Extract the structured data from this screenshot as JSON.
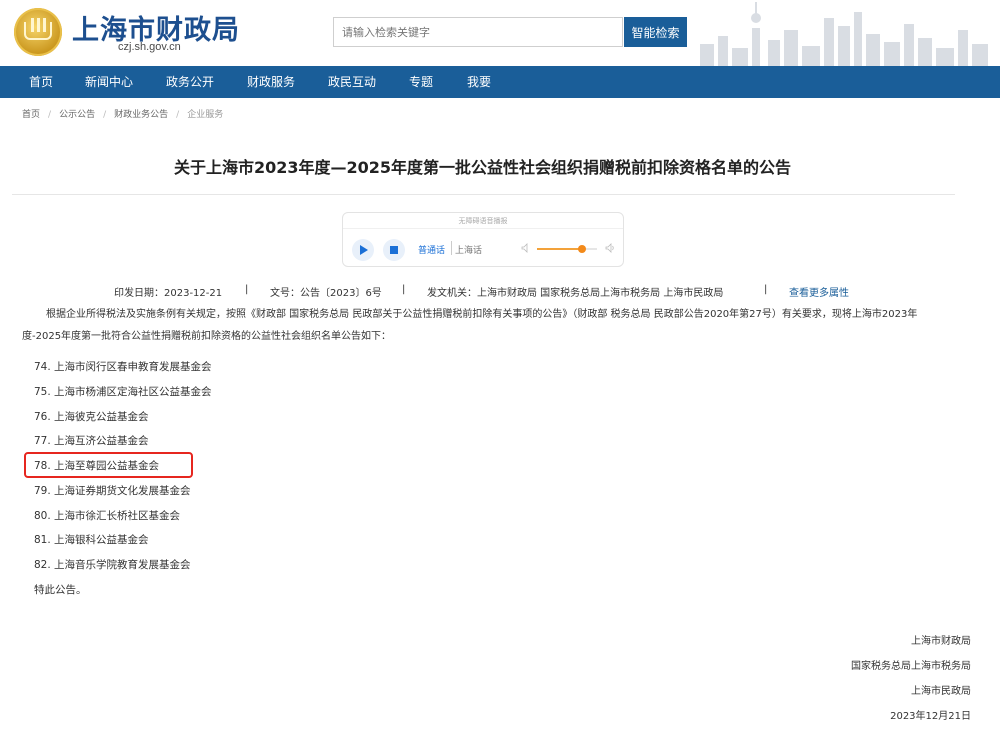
{
  "header": {
    "site_title": "上海市财政局",
    "site_url": "czj.sh.gov.cn",
    "search_placeholder": "请输入检索关键字",
    "search_button": "智能检索"
  },
  "nav": [
    "首页",
    "新闻中心",
    "政务公开",
    "财政服务",
    "政民互动",
    "专题",
    "我要"
  ],
  "breadcrumb": [
    "首页",
    "公示公告",
    "财政业务公告",
    "企业服务"
  ],
  "title": "关于上海市2023年度—2025年度第一批公益性社会组织捐赠税前扣除资格名单的公告",
  "player": {
    "header": "无障碍语音播报",
    "lang_a": "普通话",
    "lang_b": "上海话",
    "volume_level": 0.75
  },
  "meta": {
    "print_date": "印发日期：2023-12-21",
    "doc_no": "文号：公告〔2023〕6号",
    "issuer": "发文机关：上海市财政局 国家税务总局上海市税务局 上海市民政局",
    "more_link": "查看更多属性",
    "separator": "|"
  },
  "intro": "根据企业所得税法及实施条例有关规定，按照《财政部 国家税务总局 民政部关于公益性捐赠税前扣除有关事项的公告》（财政部 税务总局 民政部公告2020年第27号）有关要求，现将上海市2023年度-2025年度第一批符合公益性捐赠税前扣除资格的公益性社会组织名单公告如下：",
  "list": [
    "74.  上海市闵行区春申教育发展基金会",
    "75.  上海市杨浦区定海社区公益基金会",
    "76.  上海彼克公益基金会",
    "77.  上海互济公益基金会",
    "78.  上海至尊园公益基金会",
    "79.  上海证券期货文化发展基金会",
    "80.  上海市徐汇长桥社区基金会",
    "81.  上海银科公益基金会",
    "82.  上海音乐学院教育发展基金会"
  ],
  "closing": "特此公告。",
  "signatures": [
    "上海市财政局",
    "国家税务总局上海市税务局",
    "上海市民政局",
    "2023年12月21日"
  ],
  "colors": {
    "brand_blue": "#1a5e99",
    "highlight_red": "#e6261f"
  }
}
